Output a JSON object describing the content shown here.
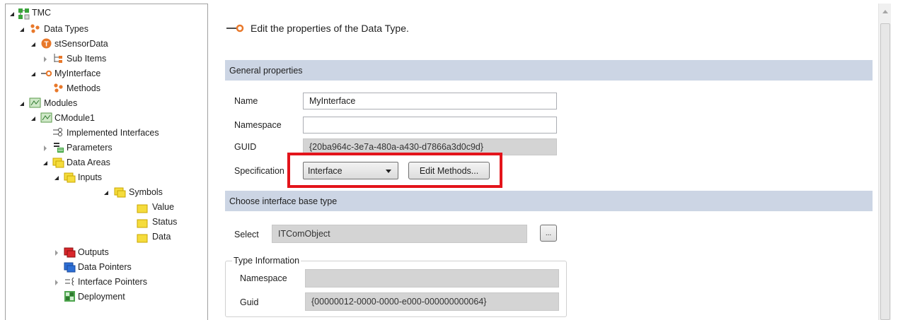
{
  "tree": {
    "items": [
      {
        "label": "TMC"
      },
      {
        "label": "Data Types"
      },
      {
        "label": "stSensorData"
      },
      {
        "label": "Sub Items"
      },
      {
        "label": "MyInterface"
      },
      {
        "label": "Methods"
      },
      {
        "label": "Modules"
      },
      {
        "label": "CModule1"
      },
      {
        "label": "Implemented Interfaces"
      },
      {
        "label": "Parameters"
      },
      {
        "label": "Data Areas"
      },
      {
        "label": "Inputs"
      },
      {
        "label": "Symbols"
      },
      {
        "label": "Value"
      },
      {
        "label": "Status"
      },
      {
        "label": "Data"
      },
      {
        "label": "Outputs"
      },
      {
        "label": "Data Pointers"
      },
      {
        "label": "Interface Pointers"
      },
      {
        "label": "Deployment"
      }
    ]
  },
  "header": {
    "text": "Edit the properties of the Data Type."
  },
  "general": {
    "title": "General properties",
    "name_label": "Name",
    "name_value": "MyInterface",
    "namespace_label": "Namespace",
    "namespace_value": "",
    "guid_label": "GUID",
    "guid_value": "{20ba964c-3e7a-480a-a430-d7866a3d0c9d}",
    "spec_label": "Specification",
    "spec_value": "Interface",
    "edit_methods_label": "Edit Methods..."
  },
  "base_type": {
    "title": "Choose interface base type",
    "select_label": "Select",
    "select_value": "ITComObject",
    "browse_label": "...",
    "type_info_title": "Type Information",
    "namespace_label": "Namespace",
    "namespace_value": "",
    "guid_label": "Guid",
    "guid_value": "{00000012-0000-0000-e000-000000000064}"
  },
  "colors": {
    "section_bar": "#ccd5e4",
    "highlight": "#e3141b",
    "folder_yellow": "#f5dc3c",
    "interface_orange": "#e8782a"
  }
}
